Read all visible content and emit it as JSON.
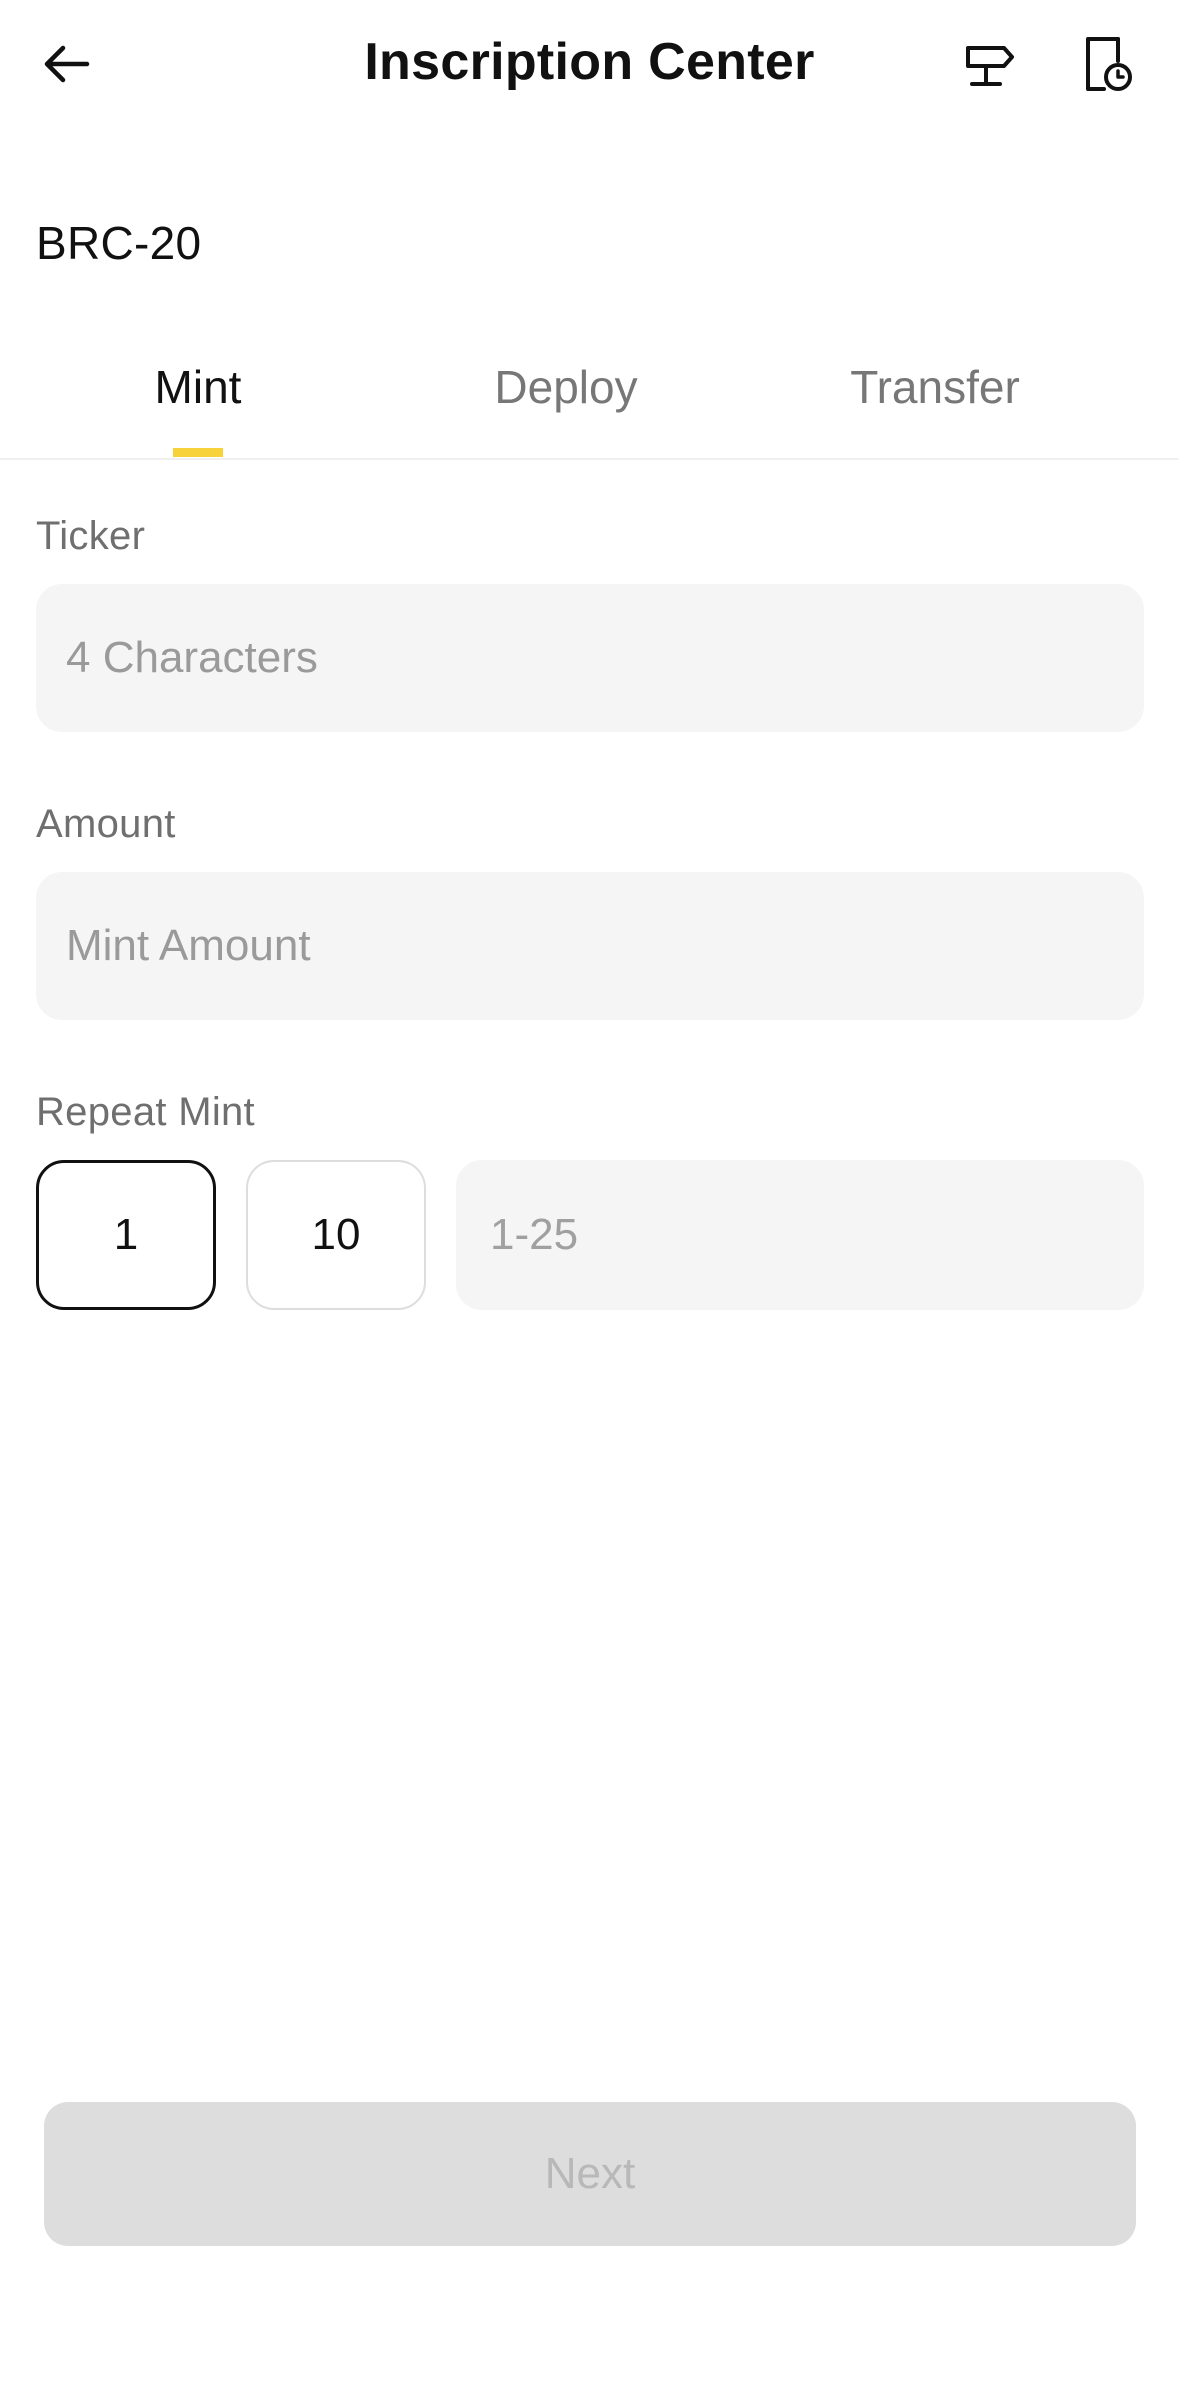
{
  "header": {
    "title": "Inscription Center",
    "back_icon": "arrow-left-icon",
    "signpost_icon": "signpost-icon",
    "history_icon": "document-clock-icon"
  },
  "section": {
    "label": "BRC-20"
  },
  "tabs": [
    {
      "label": "Mint",
      "active": true
    },
    {
      "label": "Deploy",
      "active": false
    },
    {
      "label": "Transfer",
      "active": false
    }
  ],
  "form": {
    "ticker": {
      "label": "Ticker",
      "value": "",
      "placeholder": "4 Characters"
    },
    "amount": {
      "label": "Amount",
      "value": "",
      "placeholder": "Mint Amount"
    },
    "repeat": {
      "label": "Repeat Mint",
      "options": [
        "1",
        "10"
      ],
      "selected": "1",
      "custom_value": "",
      "custom_placeholder": "1-25"
    }
  },
  "footer": {
    "next_label": "Next",
    "next_enabled": false
  },
  "colors": {
    "accent": "#f7d23b",
    "input_bg": "#f5f5f5",
    "disabled_button_bg": "#dddddd",
    "disabled_button_text": "#b8b8b8"
  }
}
